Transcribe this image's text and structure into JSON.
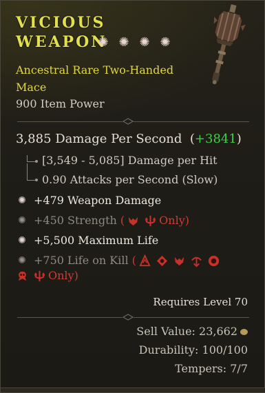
{
  "item": {
    "title_line1": "VICIOUS",
    "title_line2": "WEAPON",
    "rating_star_count": 4,
    "subtitle": "Ancestral Rare Two-Handed Mace",
    "item_power": "900 Item Power",
    "colors": {
      "title": "#e3e050",
      "rare_yellow": "#e2d63f",
      "positive_green": "#3ecf4a",
      "class_restriction_red": "#d23a32"
    }
  },
  "stats": {
    "dps": "3,885 Damage Per Second",
    "dps_delta_open": "(",
    "dps_delta": "+3841",
    "dps_delta_close": ")",
    "damage_per_hit": "[3,549 - 5,085] Damage per Hit",
    "attacks_per_second": "0.90 Attacks per Second (Slow)"
  },
  "affixes": [
    {
      "text": "+479 Weapon Damage",
      "style": "white"
    },
    {
      "text": "+450 Strength",
      "style": "dim",
      "restriction": {
        "open": "(",
        "icons": [
          "barbarian-class-icon",
          "druid-class-icon"
        ],
        "suffix": "Only)"
      }
    },
    {
      "text": "+5,500 Maximum Life",
      "style": "white"
    },
    {
      "text": "+750 Life on Kill",
      "style": "dim",
      "restriction": {
        "open": "(",
        "icons": [
          "barbarian-class-icon",
          "druid-class-icon",
          "necromancer-class-icon",
          "rogue-class-icon",
          "sorcerer-class-icon",
          "spiritborn-class-icon",
          "druid-class-icon"
        ],
        "suffix": "Only)"
      }
    }
  ],
  "footer": {
    "requires_level": "Requires Level 70",
    "sell_value": "Sell Value: 23,662",
    "durability": "Durability: 100/100",
    "tempers": "Tempers: 7/7"
  }
}
